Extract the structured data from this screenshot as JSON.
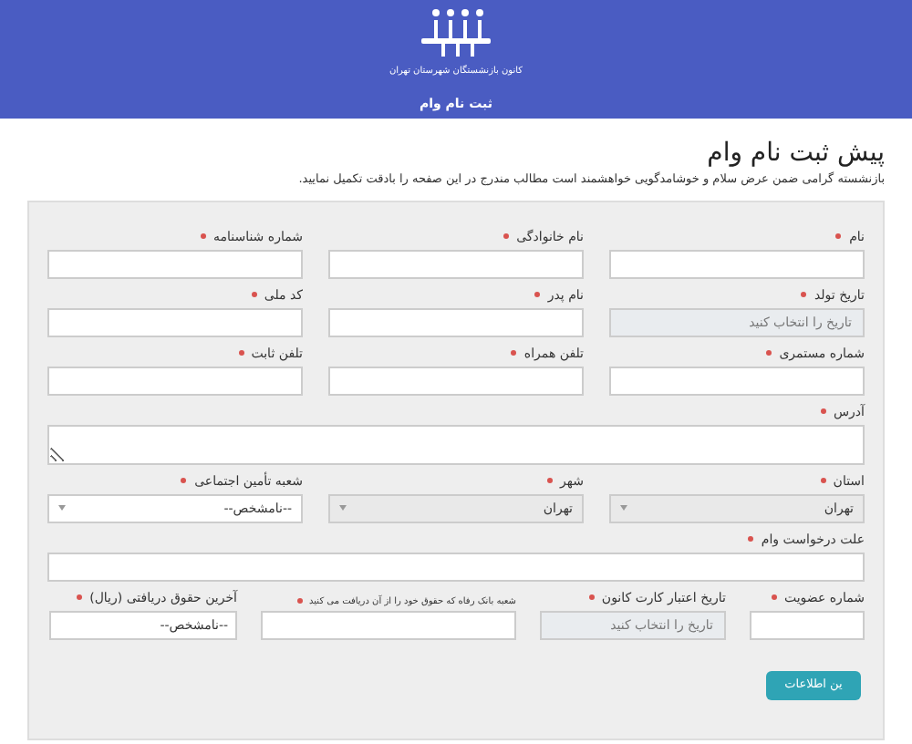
{
  "header": {
    "organization": "کانون بازنشستگان شهرستان تهران",
    "page_title": "ثبت نام وام"
  },
  "title": "پیش ثبت نام وام",
  "intro": "بازنشسته گرامی ضمن عرض سلام و خوشامدگویی خواهشمند است مطالب مندرج در این صفحه را بادقت تکمیل نمایید.",
  "form": {
    "rows": [
      {
        "fields": [
          {
            "label": "نام",
            "required": true,
            "kind": "text"
          },
          {
            "label": "نام خانوادگی",
            "required": true,
            "kind": "text"
          },
          {
            "label": "شماره شناسنامه",
            "required": true,
            "kind": "text"
          }
        ]
      },
      {
        "fields": [
          {
            "label": "تاریخ تولد",
            "required": true,
            "kind": "date",
            "placeholder": "تاریخ را انتخاب کنید"
          },
          {
            "label": "نام پدر",
            "required": true,
            "kind": "text"
          },
          {
            "label": "کد ملی",
            "required": true,
            "kind": "text"
          }
        ]
      },
      {
        "fields": [
          {
            "label": "شماره مستمری",
            "required": true,
            "kind": "text"
          },
          {
            "label": "تلفن همراه",
            "required": true,
            "kind": "text"
          },
          {
            "label": "تلفن ثابت",
            "required": true,
            "kind": "text"
          }
        ]
      },
      {
        "fields": [
          {
            "label": "آدرس",
            "required": true,
            "kind": "textarea"
          }
        ]
      },
      {
        "fields": [
          {
            "label": "استان",
            "required": true,
            "kind": "select",
            "value": "تهران",
            "disabled": true
          },
          {
            "label": "شهر",
            "required": true,
            "kind": "select",
            "value": "تهران",
            "disabled": true
          },
          {
            "label": "شعبه تأمین اجتماعی",
            "required": true,
            "kind": "select",
            "value": "--نامشخص--",
            "disabled": false
          }
        ]
      },
      {
        "fields": [
          {
            "label": "علت درخواست وام",
            "required": true,
            "kind": "text"
          }
        ]
      },
      {
        "fields": [
          {
            "label": "شماره عضویت",
            "required": true,
            "kind": "text"
          },
          {
            "label": "تاریخ اعتبار کارت کانون",
            "required": true,
            "kind": "date",
            "placeholder": "تاریخ را انتخاب کنید"
          },
          {
            "label": "شعبه بانک رفاه که حقوق خود را از آن دریافت می کنید",
            "required": true,
            "kind": "text",
            "small_label": true
          },
          {
            "label": "آخرین حقوق دریافتی (ریال)",
            "required": true,
            "kind": "text",
            "value": "--نامشخص--"
          }
        ]
      }
    ],
    "submit": "ین اطلاعات"
  }
}
